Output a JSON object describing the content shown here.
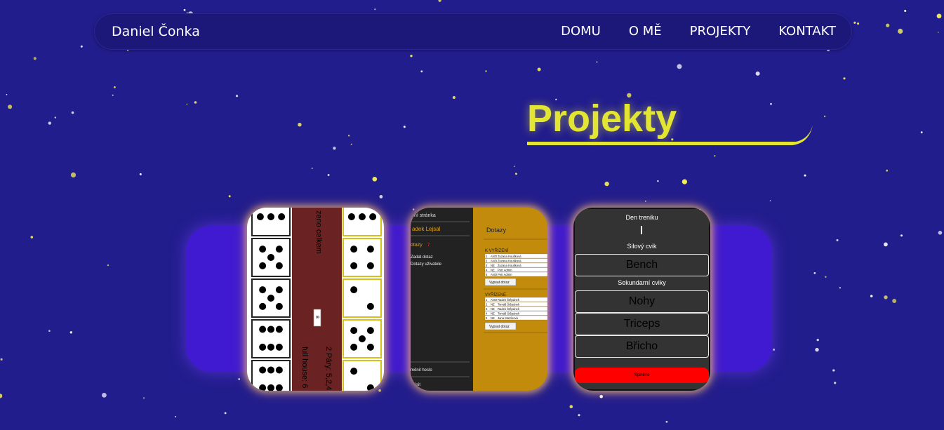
{
  "colors": {
    "background": "#221d8d",
    "navbar": "#1c1879",
    "accent_yellow": "#e3e533",
    "carousel": "#3f1ad0",
    "dotazy_gold": "#c38b0c",
    "dice_panel": "#6b2222",
    "submit_red": "#ff0000"
  },
  "nav": {
    "brand": "Daniel Čonka",
    "links": [
      "DOMU",
      "O MĚ",
      "PROJEKTY",
      "KONTAKT"
    ]
  },
  "page": {
    "title": "Projekty"
  },
  "projects": {
    "dice": {
      "text_total": "zeno celkem",
      "text_pairs": "2 Páry: 5,2,4",
      "text_fullhouse": "full house: 6",
      "box_value": "8",
      "left_faces": [
        3,
        5,
        5,
        6,
        6
      ],
      "right_faces": [
        3,
        4,
        2,
        5,
        2
      ]
    },
    "dotazy": {
      "sidebar_title": "ní stránka",
      "user_name": "adek Lejsal",
      "menu_dotazy": "otazy",
      "menu_zadat": "Zadat dotaz",
      "menu_dotazy_uzivatele": "Dotazy uživatele",
      "bottom_link_1": "měnit heslo",
      "bottom_link_2": "hlásit",
      "header": "Dotazy",
      "section_1": "K VYŘÍZENÍ",
      "section_2": "VYŘÍZENÉ",
      "button": "Vypsat dotaz",
      "rows_1": [
        [
          "1",
          "ANO",
          "Zuzana Koušková"
        ],
        [
          "2",
          "ANO",
          "Zuzana Koušková"
        ],
        [
          "3",
          "NE",
          "Zuzana Koušková"
        ],
        [
          "4",
          "NE",
          "Petr Admin"
        ],
        [
          "5",
          "ANO",
          "Petr Admin"
        ]
      ],
      "rows_2": [
        [
          "1",
          "ANO",
          "Radek Štěpánek"
        ],
        [
          "2",
          "NE",
          "Tomáš Štěpánek"
        ],
        [
          "3",
          "NE",
          "Radek Štěpánek"
        ],
        [
          "4",
          "NE",
          "Tomáš Štěpánek"
        ],
        [
          "5",
          "NE",
          "Jana Martínová"
        ]
      ]
    },
    "trenink": {
      "day_label": "Den treniku",
      "strength_label": "Silový cvik",
      "strength_button": "Bench",
      "secondary_label": "Sekundarní cviky",
      "secondary_buttons": [
        "Nohy",
        "Triceps",
        "Břicho"
      ],
      "submit": "Splněno"
    }
  }
}
